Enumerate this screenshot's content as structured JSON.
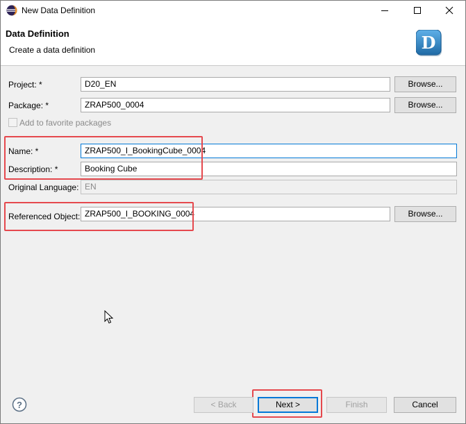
{
  "window": {
    "title": "New Data Definition"
  },
  "banner": {
    "title": "Data Definition",
    "subtitle": "Create a data definition",
    "logo_letter": "D"
  },
  "form": {
    "project": {
      "label": "Project: *",
      "value": "D20_EN",
      "browse": "Browse..."
    },
    "package": {
      "label": "Package: *",
      "value": "ZRAP500_0004",
      "browse": "Browse..."
    },
    "favorite": {
      "label": "Add to favorite packages",
      "checked": false
    },
    "name": {
      "label": "Name: *",
      "value": "ZRAP500_I_BookingCube_0004"
    },
    "description": {
      "label": "Description: *",
      "value": "Booking Cube"
    },
    "language": {
      "label": "Original Language:",
      "value": "EN"
    },
    "referenced": {
      "label": "Referenced Object:",
      "value": "ZRAP500_I_BOOKING_0004",
      "browse": "Browse..."
    }
  },
  "footer": {
    "back": "< Back",
    "next": "Next >",
    "finish": "Finish",
    "cancel": "Cancel"
  },
  "colors": {
    "highlight": "#e5484d",
    "accent": "#0078d7",
    "logo": "#2a7ab8"
  },
  "icons": {
    "app": "eclipse-icon",
    "minimize": "minimize-icon",
    "maximize": "maximize-icon",
    "close": "close-icon",
    "logo": "data-definition-logo-icon",
    "help": "help-icon",
    "cursor": "mouse-cursor-icon"
  }
}
